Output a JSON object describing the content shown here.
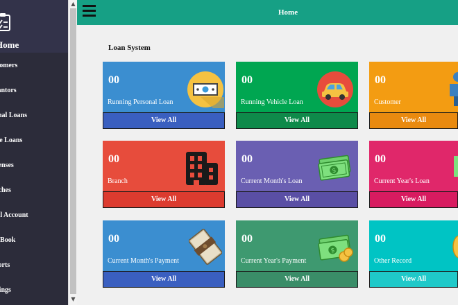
{
  "sidebar": {
    "home_label": "Home",
    "items": [
      {
        "label": "stomers"
      },
      {
        "label": "rantors"
      },
      {
        "label": "onal Loans"
      },
      {
        "label": "cle Loans"
      },
      {
        "label": "penses"
      },
      {
        "label": "nches"
      },
      {
        "label": "tal Account"
      },
      {
        "label": "k Book"
      },
      {
        "label": "ports"
      },
      {
        "label": "ttings"
      }
    ]
  },
  "scrollbar": {
    "up_arrow": "▲",
    "down_arrow": "▼"
  },
  "topbar": {
    "title": "Home"
  },
  "main": {
    "section_title": "Loan System",
    "cards": [
      {
        "count": "00",
        "label": "Running Personal Loan",
        "button": "View All",
        "color": "#3b8ed0",
        "button_color": "#3a5fc0",
        "icon": "cash-icon"
      },
      {
        "count": "00",
        "label": "Running Vehicle Loan",
        "button": "View All",
        "color": "#00a651",
        "button_color": "#0e8a4a",
        "icon": "car-icon"
      },
      {
        "count": "00",
        "label": "Customer",
        "button": "View All",
        "color": "#f39c12",
        "button_color": "#e98a0f",
        "icon": "person-icon"
      },
      {
        "count": "00",
        "label": "Branch",
        "button": "View All",
        "color": "#e74c3c",
        "button_color": "#dc3b2f",
        "icon": "building-icon"
      },
      {
        "count": "00",
        "label": "Current Month's Loan",
        "button": "View All",
        "color": "#6a5fb2",
        "button_color": "#5a4fa5",
        "icon": "money-stack-icon"
      },
      {
        "count": "00",
        "label": "Current Year's Loan",
        "button": "View All",
        "color": "#e0276a",
        "button_color": "#d81b60",
        "icon": "money-icon"
      },
      {
        "count": "00",
        "label": "Current Month's Payment",
        "button": "View All",
        "color": "#3b8ed0",
        "button_color": "#3a5fc0",
        "icon": "money-bundle-icon"
      },
      {
        "count": "00",
        "label": "Current Year's Payment",
        "button": "View All",
        "color": "#3e9970",
        "button_color": "#3a8d68",
        "icon": "money-coins-icon"
      },
      {
        "count": "00",
        "label": "Other Record",
        "button": "View All",
        "color": "#00c4c4",
        "button_color": "#1fc9c9",
        "icon": "coin-icon"
      }
    ]
  }
}
